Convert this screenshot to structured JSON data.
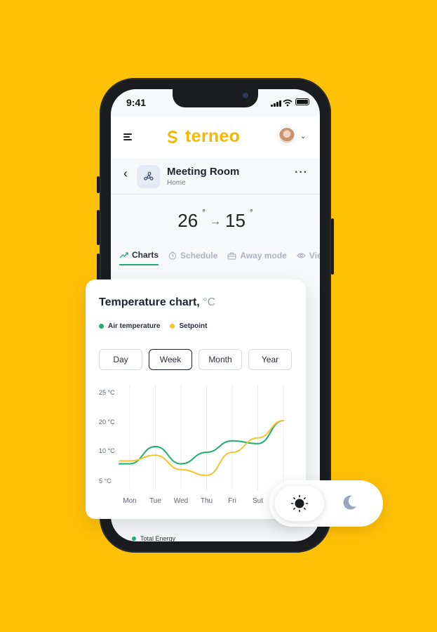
{
  "status_bar": {
    "time": "9:41"
  },
  "app": {
    "brand": "terneo",
    "brand_color": "#F5B700"
  },
  "room": {
    "title": "Meeting Room",
    "subtitle": "Home"
  },
  "temperature": {
    "current": "26",
    "target": "15",
    "degree": "°"
  },
  "tabs": [
    {
      "label": "Charts",
      "icon": "trend-icon",
      "active": true
    },
    {
      "label": "Schedule",
      "icon": "clock-icon",
      "active": false
    },
    {
      "label": "Away mode",
      "icon": "suitcase-icon",
      "active": false
    },
    {
      "label": "View",
      "icon": "eye-icon",
      "active": false
    }
  ],
  "card": {
    "title": "Temperature chart,",
    "unit": "°C",
    "legend": [
      {
        "label": "Air temperature",
        "color": "#1fae6d"
      },
      {
        "label": "Setpoint",
        "color": "#F5C431"
      }
    ],
    "periods": [
      "Day",
      "Week",
      "Month",
      "Year"
    ],
    "active_period": "Week"
  },
  "chart_data": {
    "type": "line",
    "x": [
      "Mon",
      "Tue",
      "Wed",
      "Thu",
      "Fri",
      "Sut",
      "Sun"
    ],
    "y_ticks": [
      "25 °C",
      "20 °C",
      "10 °C",
      "5 °C"
    ],
    "series": [
      {
        "name": "Air temperature",
        "color": "#1fae6d",
        "values": [
          12.5,
          15.5,
          12.5,
          14.5,
          16.5,
          16,
          20
        ]
      },
      {
        "name": "Setpoint",
        "color": "#F5C431",
        "values": [
          13,
          14,
          11.5,
          10.5,
          14.5,
          17,
          20
        ]
      }
    ]
  },
  "footer": {
    "total_label": "Total Energy"
  },
  "theme_toggle": {
    "selected": "light"
  }
}
